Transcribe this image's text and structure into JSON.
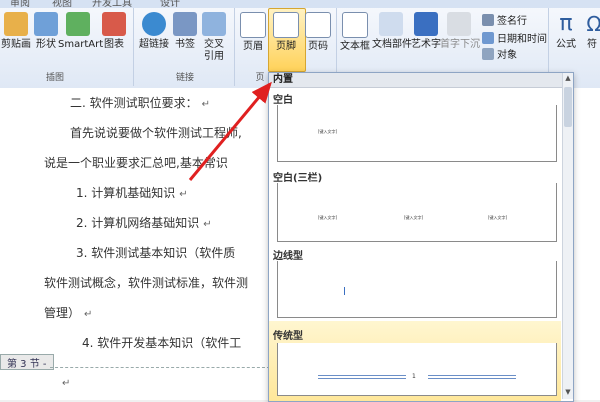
{
  "tabs": [
    "审阅",
    "视图",
    "开发工具",
    "设计"
  ],
  "ribbon": {
    "paste_picture": "剪贴画",
    "shapes": "形状",
    "smartart": "SmartArt",
    "chart": "图表",
    "hyperlink": "超链接",
    "bookmark": "书签",
    "cross_ref": "交叉\n引用",
    "header": "页眉",
    "footer": "页脚",
    "page_number": "页码",
    "textbox": "文本框",
    "quick_parts": "文档部件",
    "wordart": "艺术字",
    "dropcap": "首字下沉",
    "signature_line": "签名行",
    "datetime": "日期和时间",
    "object": "对象",
    "formula": "公式",
    "symbol": "符",
    "group_illustrations": "插图",
    "group_links": "链接",
    "group_header": "页"
  },
  "document": {
    "lines": [
      "二. 软件测试职位要求：",
      "首先说说要做个软件测试工程师,",
      "说是一个职业要求汇总吧,基本常识",
      "1.   计算机基础知识",
      "2.   计算机网络基础知识",
      "3.   软件测试基本知识（软件质",
      "软件测试概念，软件测试标准，软件测",
      "管理）",
      "4.   软件开发基本知识（软件工"
    ],
    "section_label": "第 3 节 -"
  },
  "footer_gallery": {
    "builtin": "内置",
    "items": [
      "空白",
      "空白(三栏)",
      "边线型",
      "传统型"
    ],
    "placeholder": "[键入文字]"
  }
}
